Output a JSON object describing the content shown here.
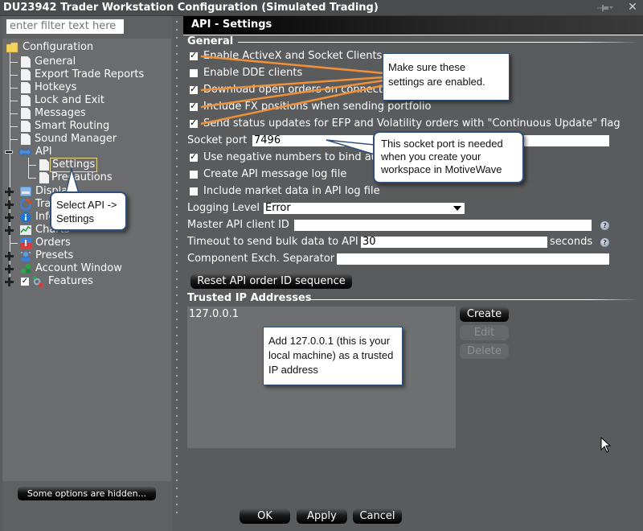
{
  "window": {
    "title": "DU23942 Trader Workstation Configuration (Simulated Trading)",
    "pin_icon": "pin-icon",
    "close_icon": "close-icon"
  },
  "sidebar": {
    "filter_placeholder": "enter filter text here",
    "root": "Configuration",
    "items": [
      {
        "label": "General",
        "icon": "document-icon"
      },
      {
        "label": "Export Trade Reports",
        "icon": "document-icon"
      },
      {
        "label": "Hotkeys",
        "icon": "document-icon"
      },
      {
        "label": "Lock and Exit",
        "icon": "document-icon"
      },
      {
        "label": "Messages",
        "icon": "document-icon"
      },
      {
        "label": "Smart Routing",
        "icon": "document-icon"
      },
      {
        "label": "Sound Manager",
        "icon": "document-icon"
      },
      {
        "label": "API",
        "icon": "api-arrows-icon",
        "expanded": true,
        "children": [
          {
            "label": "Settings",
            "selected": true
          },
          {
            "label": "Precautions"
          }
        ]
      },
      {
        "label": "Display",
        "icon": "display-icon",
        "collapsed": true
      },
      {
        "label": "Trading",
        "icon": "trading-icon",
        "collapsed": true
      },
      {
        "label": "Information",
        "icon": "info-icon",
        "collapsed": true
      },
      {
        "label": "Charts",
        "icon": "chart-icon",
        "collapsed": true
      },
      {
        "label": "Orders",
        "icon": "orders-icon"
      },
      {
        "label": "Presets",
        "icon": "presets-icon",
        "collapsed": true
      },
      {
        "label": "Account Window",
        "icon": "account-window-icon",
        "collapsed": true
      },
      {
        "label": "Features",
        "icon": "features-icon",
        "collapsed": true
      }
    ],
    "hidden_options_button": "Some options are hidden..."
  },
  "panel": {
    "header": "API - Settings",
    "general_section": "General",
    "checkboxes": [
      {
        "label": "Enable ActiveX and Socket Clients",
        "checked": true
      },
      {
        "label": "Enable DDE clients",
        "checked": false
      },
      {
        "label": "Download open orders on connection",
        "checked": true
      },
      {
        "label": "Include FX positions when sending portfolio",
        "checked": true
      },
      {
        "label": "Send status updates for EFP and Volatility orders with \"Continuous Update\" flag",
        "checked": true
      }
    ],
    "socket_port_label": "Socket port",
    "socket_port_value": "7496",
    "checkboxes2": [
      {
        "label": "Use negative numbers to bind automatic orders",
        "checked": true
      },
      {
        "label": "Create API message log file",
        "checked": false
      },
      {
        "label": "Include market data in API log file",
        "checked": false
      }
    ],
    "logging_level_label": "Logging Level",
    "logging_level_value": "Error",
    "master_client_label": "Master API client ID",
    "master_client_value": "",
    "timeout_label": "Timeout to send bulk data to API",
    "timeout_value": "30",
    "timeout_unit": "seconds",
    "separator_label": "Component Exch. Separator",
    "separator_value": "",
    "reset_button": "Reset API order ID sequence",
    "trusted_section": "Trusted IP Addresses",
    "trusted_ips": [
      "127.0.0.1"
    ],
    "create_button": "Create",
    "edit_button": "Edit",
    "delete_button": "Delete"
  },
  "footer": {
    "ok": "OK",
    "apply": "Apply",
    "cancel": "Cancel"
  },
  "callouts": {
    "enable_settings": "Make sure these settings are enabled.",
    "socket_port": "This socket port is needed when you create your workspace in MotiveWave",
    "select_api": "Select API -> Settings",
    "trusted_ip": "Add 127.0.0.1 (this is your local machine) as a trusted IP address",
    "line_color": "#f0913a"
  }
}
